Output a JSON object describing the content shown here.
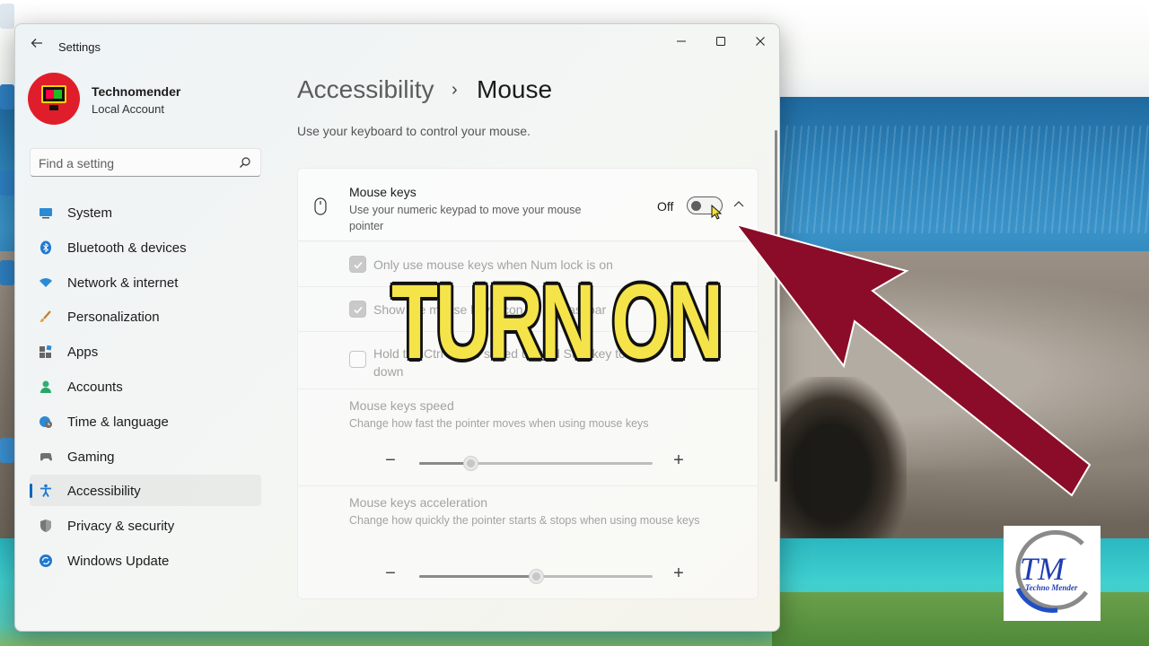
{
  "app": {
    "title": "Settings",
    "back_icon": "back-arrow-icon",
    "window_controls": [
      "minimize-icon",
      "maximize-icon",
      "close-icon"
    ]
  },
  "profile": {
    "name": "Technomender",
    "account_type": "Local Account"
  },
  "search": {
    "placeholder": "Find a setting"
  },
  "sidebar": {
    "items": [
      {
        "label": "System",
        "icon": "system-icon",
        "selected": false
      },
      {
        "label": "Bluetooth & devices",
        "icon": "bluetooth-icon",
        "selected": false
      },
      {
        "label": "Network & internet",
        "icon": "wifi-icon",
        "selected": false
      },
      {
        "label": "Personalization",
        "icon": "brush-icon",
        "selected": false
      },
      {
        "label": "Apps",
        "icon": "apps-icon",
        "selected": false
      },
      {
        "label": "Accounts",
        "icon": "person-icon",
        "selected": false
      },
      {
        "label": "Time & language",
        "icon": "globe-clock-icon",
        "selected": false
      },
      {
        "label": "Gaming",
        "icon": "gamepad-icon",
        "selected": false
      },
      {
        "label": "Accessibility",
        "icon": "accessibility-icon",
        "selected": true
      },
      {
        "label": "Privacy & security",
        "icon": "shield-icon",
        "selected": false
      },
      {
        "label": "Windows Update",
        "icon": "update-icon",
        "selected": false
      }
    ]
  },
  "breadcrumb": {
    "parent": "Accessibility",
    "separator": "›",
    "current": "Mouse"
  },
  "page": {
    "description": "Use your keyboard to control your mouse."
  },
  "mouse_keys": {
    "title": "Mouse keys",
    "description": "Use your numeric keypad to move your mouse pointer",
    "state_label": "Off",
    "enabled": false
  },
  "options": {
    "numlock": {
      "label": "Only use mouse keys when Num lock is on",
      "checked": true
    },
    "taskbar": {
      "label": "Show the mouse keys icon on the taskbar",
      "checked": true
    },
    "ctrl_shift": {
      "label": "Hold the Ctrl key to speed up and Shift key to slow down",
      "checked": false
    }
  },
  "sliders": {
    "speed": {
      "title": "Mouse keys speed",
      "description": "Change how fast the pointer moves when using mouse keys",
      "value": 0.22
    },
    "acceleration": {
      "title": "Mouse keys acceleration",
      "description": "Change how quickly the pointer starts & stops when using mouse keys",
      "value": 0.5
    }
  },
  "overlay": {
    "text": "TURN ON",
    "text_color": "#f5e34a",
    "arrow_color": "#8b0c28"
  },
  "watermark": {
    "initials": "TM",
    "name": "Techno Mender"
  },
  "colors": {
    "accent": "#0067c0",
    "avatar_bg": "#e01e2b"
  }
}
